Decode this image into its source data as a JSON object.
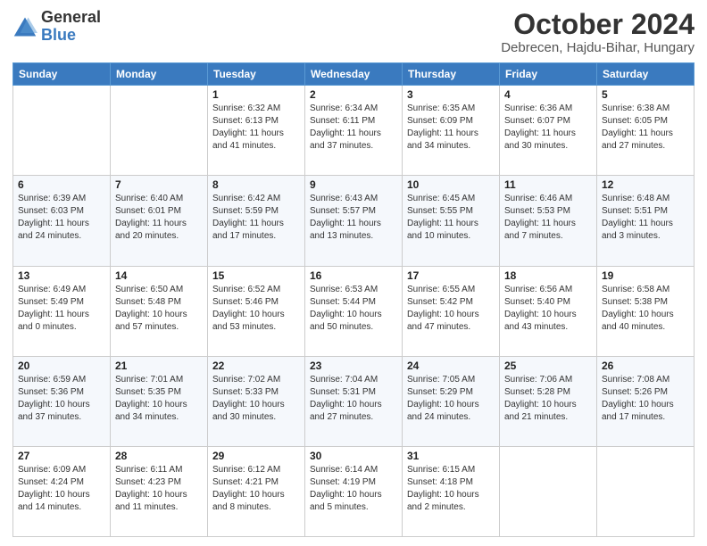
{
  "logo": {
    "general": "General",
    "blue": "Blue"
  },
  "header": {
    "title": "October 2024",
    "subtitle": "Debrecen, Hajdu-Bihar, Hungary"
  },
  "weekdays": [
    "Sunday",
    "Monday",
    "Tuesday",
    "Wednesday",
    "Thursday",
    "Friday",
    "Saturday"
  ],
  "weeks": [
    [
      {
        "day": "",
        "info": ""
      },
      {
        "day": "",
        "info": ""
      },
      {
        "day": "1",
        "info": "Sunrise: 6:32 AM\nSunset: 6:13 PM\nDaylight: 11 hours and 41 minutes."
      },
      {
        "day": "2",
        "info": "Sunrise: 6:34 AM\nSunset: 6:11 PM\nDaylight: 11 hours and 37 minutes."
      },
      {
        "day": "3",
        "info": "Sunrise: 6:35 AM\nSunset: 6:09 PM\nDaylight: 11 hours and 34 minutes."
      },
      {
        "day": "4",
        "info": "Sunrise: 6:36 AM\nSunset: 6:07 PM\nDaylight: 11 hours and 30 minutes."
      },
      {
        "day": "5",
        "info": "Sunrise: 6:38 AM\nSunset: 6:05 PM\nDaylight: 11 hours and 27 minutes."
      }
    ],
    [
      {
        "day": "6",
        "info": "Sunrise: 6:39 AM\nSunset: 6:03 PM\nDaylight: 11 hours and 24 minutes."
      },
      {
        "day": "7",
        "info": "Sunrise: 6:40 AM\nSunset: 6:01 PM\nDaylight: 11 hours and 20 minutes."
      },
      {
        "day": "8",
        "info": "Sunrise: 6:42 AM\nSunset: 5:59 PM\nDaylight: 11 hours and 17 minutes."
      },
      {
        "day": "9",
        "info": "Sunrise: 6:43 AM\nSunset: 5:57 PM\nDaylight: 11 hours and 13 minutes."
      },
      {
        "day": "10",
        "info": "Sunrise: 6:45 AM\nSunset: 5:55 PM\nDaylight: 11 hours and 10 minutes."
      },
      {
        "day": "11",
        "info": "Sunrise: 6:46 AM\nSunset: 5:53 PM\nDaylight: 11 hours and 7 minutes."
      },
      {
        "day": "12",
        "info": "Sunrise: 6:48 AM\nSunset: 5:51 PM\nDaylight: 11 hours and 3 minutes."
      }
    ],
    [
      {
        "day": "13",
        "info": "Sunrise: 6:49 AM\nSunset: 5:49 PM\nDaylight: 11 hours and 0 minutes."
      },
      {
        "day": "14",
        "info": "Sunrise: 6:50 AM\nSunset: 5:48 PM\nDaylight: 10 hours and 57 minutes."
      },
      {
        "day": "15",
        "info": "Sunrise: 6:52 AM\nSunset: 5:46 PM\nDaylight: 10 hours and 53 minutes."
      },
      {
        "day": "16",
        "info": "Sunrise: 6:53 AM\nSunset: 5:44 PM\nDaylight: 10 hours and 50 minutes."
      },
      {
        "day": "17",
        "info": "Sunrise: 6:55 AM\nSunset: 5:42 PM\nDaylight: 10 hours and 47 minutes."
      },
      {
        "day": "18",
        "info": "Sunrise: 6:56 AM\nSunset: 5:40 PM\nDaylight: 10 hours and 43 minutes."
      },
      {
        "day": "19",
        "info": "Sunrise: 6:58 AM\nSunset: 5:38 PM\nDaylight: 10 hours and 40 minutes."
      }
    ],
    [
      {
        "day": "20",
        "info": "Sunrise: 6:59 AM\nSunset: 5:36 PM\nDaylight: 10 hours and 37 minutes."
      },
      {
        "day": "21",
        "info": "Sunrise: 7:01 AM\nSunset: 5:35 PM\nDaylight: 10 hours and 34 minutes."
      },
      {
        "day": "22",
        "info": "Sunrise: 7:02 AM\nSunset: 5:33 PM\nDaylight: 10 hours and 30 minutes."
      },
      {
        "day": "23",
        "info": "Sunrise: 7:04 AM\nSunset: 5:31 PM\nDaylight: 10 hours and 27 minutes."
      },
      {
        "day": "24",
        "info": "Sunrise: 7:05 AM\nSunset: 5:29 PM\nDaylight: 10 hours and 24 minutes."
      },
      {
        "day": "25",
        "info": "Sunrise: 7:06 AM\nSunset: 5:28 PM\nDaylight: 10 hours and 21 minutes."
      },
      {
        "day": "26",
        "info": "Sunrise: 7:08 AM\nSunset: 5:26 PM\nDaylight: 10 hours and 17 minutes."
      }
    ],
    [
      {
        "day": "27",
        "info": "Sunrise: 6:09 AM\nSunset: 4:24 PM\nDaylight: 10 hours and 14 minutes."
      },
      {
        "day": "28",
        "info": "Sunrise: 6:11 AM\nSunset: 4:23 PM\nDaylight: 10 hours and 11 minutes."
      },
      {
        "day": "29",
        "info": "Sunrise: 6:12 AM\nSunset: 4:21 PM\nDaylight: 10 hours and 8 minutes."
      },
      {
        "day": "30",
        "info": "Sunrise: 6:14 AM\nSunset: 4:19 PM\nDaylight: 10 hours and 5 minutes."
      },
      {
        "day": "31",
        "info": "Sunrise: 6:15 AM\nSunset: 4:18 PM\nDaylight: 10 hours and 2 minutes."
      },
      {
        "day": "",
        "info": ""
      },
      {
        "day": "",
        "info": ""
      }
    ]
  ]
}
